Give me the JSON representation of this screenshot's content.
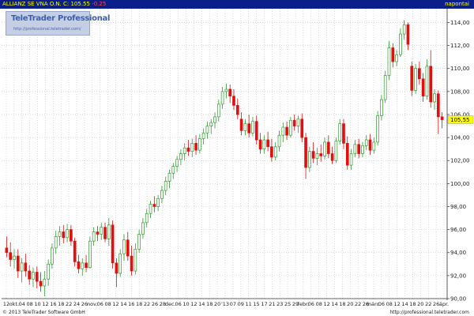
{
  "header": {
    "instrument": "ALLIANZ SE VNA O.N.",
    "close_label": "C:",
    "close": "105.55",
    "change": "-0.25",
    "source": "napontai"
  },
  "logo": {
    "title": "TeleTrader Professional",
    "url": "http://professional.teletrader.com/"
  },
  "footer": {
    "copyright": "© 2013 TeleTrader Software GmbH",
    "url": "http://professional.teletrader.com"
  },
  "colors": {
    "background": "#ffffff",
    "up": "#2e9e2e",
    "down": "#e01010",
    "grid": "#bfbfbf",
    "header": "#0a1f8a"
  },
  "chart_data": {
    "type": "candlestick",
    "yaxis_side": "right",
    "ylim": [
      90,
      115.2
    ],
    "yticks": [
      90,
      92,
      94,
      96,
      98,
      100,
      102,
      104,
      106,
      108,
      110,
      112,
      114
    ],
    "ytick_labels": [
      "90,00",
      "92,00",
      "94,00",
      "96,00",
      "98,00",
      "100,00",
      "102,00",
      "104,00",
      "106,00",
      "108,00",
      "110,00",
      "112,00",
      "114,00"
    ],
    "last_price_label": "105,55",
    "grid": true,
    "x_labels": [
      "12",
      "okt.",
      "04",
      "08",
      "10",
      "12",
      "16",
      "18",
      "22",
      "24",
      "26",
      "nov.",
      "06",
      "08",
      "12",
      "14",
      "16",
      "18",
      "22",
      "26",
      "28",
      "dec.",
      "06",
      "10",
      "12",
      "14",
      "18",
      "20",
      "'13",
      "07",
      "09",
      "11",
      "15",
      "17",
      "21",
      "23",
      "25",
      "29",
      "febr.",
      "06",
      "08",
      "12",
      "14",
      "18",
      "20",
      "22",
      "26",
      "márc.",
      "06",
      "08",
      "12",
      "14",
      "18",
      "20",
      "22",
      "26",
      "ápr."
    ],
    "candles": [
      {
        "o": 94.4,
        "h": 95.4,
        "l": 93.6,
        "c": 94.0
      },
      {
        "o": 94.0,
        "h": 94.9,
        "l": 92.8,
        "c": 93.4
      },
      {
        "o": 93.4,
        "h": 94.3,
        "l": 92.6,
        "c": 93.7
      },
      {
        "o": 93.7,
        "h": 94.3,
        "l": 91.8,
        "c": 92.4
      },
      {
        "o": 92.4,
        "h": 93.5,
        "l": 91.4,
        "c": 93.1
      },
      {
        "o": 93.1,
        "h": 93.9,
        "l": 91.9,
        "c": 92.4
      },
      {
        "o": 92.4,
        "h": 92.9,
        "l": 91.2,
        "c": 91.7
      },
      {
        "o": 91.7,
        "h": 92.7,
        "l": 91.0,
        "c": 92.3
      },
      {
        "o": 92.3,
        "h": 92.8,
        "l": 90.9,
        "c": 91.5
      },
      {
        "o": 91.5,
        "h": 92.3,
        "l": 90.6,
        "c": 91.1
      },
      {
        "o": 91.1,
        "h": 92.4,
        "l": 90.2,
        "c": 91.7
      },
      {
        "o": 91.7,
        "h": 93.4,
        "l": 91.1,
        "c": 93.0
      },
      {
        "o": 93.0,
        "h": 94.8,
        "l": 92.6,
        "c": 94.4
      },
      {
        "o": 94.4,
        "h": 95.9,
        "l": 93.9,
        "c": 95.4
      },
      {
        "o": 95.4,
        "h": 96.3,
        "l": 94.6,
        "c": 95.8
      },
      {
        "o": 95.8,
        "h": 96.4,
        "l": 94.8,
        "c": 95.3
      },
      {
        "o": 95.3,
        "h": 96.5,
        "l": 94.9,
        "c": 96.0
      },
      {
        "o": 96.0,
        "h": 96.4,
        "l": 94.6,
        "c": 95.0
      },
      {
        "o": 95.0,
        "h": 95.3,
        "l": 92.8,
        "c": 93.2
      },
      {
        "o": 93.2,
        "h": 93.8,
        "l": 92.2,
        "c": 92.6
      },
      {
        "o": 92.6,
        "h": 93.5,
        "l": 92.0,
        "c": 93.1
      },
      {
        "o": 93.1,
        "h": 93.8,
        "l": 92.3,
        "c": 92.7
      },
      {
        "o": 92.7,
        "h": 95.4,
        "l": 92.6,
        "c": 95.0
      },
      {
        "o": 95.0,
        "h": 96.2,
        "l": 94.6,
        "c": 95.8
      },
      {
        "o": 95.8,
        "h": 96.3,
        "l": 95.0,
        "c": 95.6
      },
      {
        "o": 95.6,
        "h": 96.6,
        "l": 95.1,
        "c": 96.2
      },
      {
        "o": 96.2,
        "h": 96.6,
        "l": 94.9,
        "c": 95.2
      },
      {
        "o": 95.2,
        "h": 97.0,
        "l": 94.6,
        "c": 96.4
      },
      {
        "o": 96.4,
        "h": 96.8,
        "l": 92.6,
        "c": 93.1
      },
      {
        "o": 93.1,
        "h": 93.5,
        "l": 91.0,
        "c": 92.2
      },
      {
        "o": 92.2,
        "h": 94.3,
        "l": 91.9,
        "c": 93.9
      },
      {
        "o": 93.9,
        "h": 95.6,
        "l": 93.3,
        "c": 95.1
      },
      {
        "o": 95.1,
        "h": 95.8,
        "l": 93.3,
        "c": 93.7
      },
      {
        "o": 93.7,
        "h": 94.6,
        "l": 92.0,
        "c": 92.4
      },
      {
        "o": 92.4,
        "h": 94.8,
        "l": 92.1,
        "c": 94.3
      },
      {
        "o": 94.3,
        "h": 96.0,
        "l": 94.0,
        "c": 95.6
      },
      {
        "o": 95.6,
        "h": 97.0,
        "l": 95.2,
        "c": 96.6
      },
      {
        "o": 96.6,
        "h": 97.8,
        "l": 96.2,
        "c": 97.4
      },
      {
        "o": 97.4,
        "h": 98.5,
        "l": 97.0,
        "c": 98.2
      },
      {
        "o": 98.2,
        "h": 98.9,
        "l": 97.5,
        "c": 98.0
      },
      {
        "o": 98.0,
        "h": 99.0,
        "l": 97.6,
        "c": 98.7
      },
      {
        "o": 98.7,
        "h": 99.8,
        "l": 98.3,
        "c": 99.4
      },
      {
        "o": 99.4,
        "h": 100.6,
        "l": 99.0,
        "c": 100.2
      },
      {
        "o": 100.2,
        "h": 101.2,
        "l": 99.6,
        "c": 100.9
      },
      {
        "o": 100.9,
        "h": 101.8,
        "l": 100.4,
        "c": 101.5
      },
      {
        "o": 101.5,
        "h": 102.4,
        "l": 101.0,
        "c": 102.1
      },
      {
        "o": 102.1,
        "h": 103.0,
        "l": 101.6,
        "c": 102.6
      },
      {
        "o": 102.6,
        "h": 103.5,
        "l": 102.0,
        "c": 103.1
      },
      {
        "o": 103.1,
        "h": 103.8,
        "l": 102.4,
        "c": 102.8
      },
      {
        "o": 102.8,
        "h": 103.9,
        "l": 102.3,
        "c": 103.5
      },
      {
        "o": 103.5,
        "h": 104.2,
        "l": 102.5,
        "c": 102.9
      },
      {
        "o": 102.9,
        "h": 104.3,
        "l": 102.6,
        "c": 103.9
      },
      {
        "o": 103.9,
        "h": 104.8,
        "l": 103.4,
        "c": 104.4
      },
      {
        "o": 104.4,
        "h": 105.4,
        "l": 103.9,
        "c": 105.0
      },
      {
        "o": 105.0,
        "h": 105.6,
        "l": 104.3,
        "c": 105.3
      },
      {
        "o": 105.3,
        "h": 106.2,
        "l": 104.8,
        "c": 105.8
      },
      {
        "o": 105.8,
        "h": 107.3,
        "l": 105.4,
        "c": 106.9
      },
      {
        "o": 106.9,
        "h": 108.4,
        "l": 106.5,
        "c": 108.0
      },
      {
        "o": 108.0,
        "h": 108.7,
        "l": 107.4,
        "c": 108.2
      },
      {
        "o": 108.2,
        "h": 108.6,
        "l": 107.0,
        "c": 107.6
      },
      {
        "o": 107.6,
        "h": 108.2,
        "l": 106.4,
        "c": 106.8
      },
      {
        "o": 106.8,
        "h": 107.4,
        "l": 105.6,
        "c": 106.0
      },
      {
        "o": 105.6,
        "h": 106.2,
        "l": 104.2,
        "c": 104.6
      },
      {
        "o": 104.6,
        "h": 105.6,
        "l": 104.2,
        "c": 105.2
      },
      {
        "o": 105.2,
        "h": 106.0,
        "l": 104.0,
        "c": 104.4
      },
      {
        "o": 104.4,
        "h": 105.8,
        "l": 104.1,
        "c": 105.4
      },
      {
        "o": 105.4,
        "h": 105.9,
        "l": 103.4,
        "c": 103.8
      },
      {
        "o": 103.8,
        "h": 104.4,
        "l": 102.6,
        "c": 103.0
      },
      {
        "o": 103.0,
        "h": 104.2,
        "l": 102.6,
        "c": 103.8
      },
      {
        "o": 103.8,
        "h": 104.5,
        "l": 102.8,
        "c": 103.2
      },
      {
        "o": 103.2,
        "h": 103.9,
        "l": 101.9,
        "c": 102.3
      },
      {
        "o": 102.3,
        "h": 103.6,
        "l": 102.0,
        "c": 103.2
      },
      {
        "o": 103.2,
        "h": 104.6,
        "l": 102.8,
        "c": 104.2
      },
      {
        "o": 104.2,
        "h": 105.3,
        "l": 103.6,
        "c": 104.9
      },
      {
        "o": 104.9,
        "h": 105.4,
        "l": 103.8,
        "c": 104.2
      },
      {
        "o": 104.2,
        "h": 105.8,
        "l": 104.0,
        "c": 105.5
      },
      {
        "o": 105.5,
        "h": 106.0,
        "l": 104.6,
        "c": 105.0
      },
      {
        "o": 105.0,
        "h": 105.9,
        "l": 104.4,
        "c": 105.6
      },
      {
        "o": 105.6,
        "h": 106.1,
        "l": 103.6,
        "c": 104.0
      },
      {
        "o": 104.0,
        "h": 104.4,
        "l": 100.4,
        "c": 101.4
      },
      {
        "o": 101.4,
        "h": 103.2,
        "l": 101.0,
        "c": 102.8
      },
      {
        "o": 102.8,
        "h": 103.6,
        "l": 101.8,
        "c": 102.2
      },
      {
        "o": 102.2,
        "h": 103.1,
        "l": 101.6,
        "c": 102.6
      },
      {
        "o": 102.6,
        "h": 103.4,
        "l": 101.9,
        "c": 102.4
      },
      {
        "o": 102.4,
        "h": 104.0,
        "l": 102.1,
        "c": 103.6
      },
      {
        "o": 103.6,
        "h": 104.2,
        "l": 102.2,
        "c": 102.6
      },
      {
        "o": 102.6,
        "h": 103.2,
        "l": 101.7,
        "c": 102.0
      },
      {
        "o": 102.0,
        "h": 104.0,
        "l": 101.8,
        "c": 103.7
      },
      {
        "o": 103.7,
        "h": 105.6,
        "l": 103.4,
        "c": 105.2
      },
      {
        "o": 105.2,
        "h": 105.6,
        "l": 103.0,
        "c": 103.5
      },
      {
        "o": 103.5,
        "h": 104.1,
        "l": 101.2,
        "c": 101.6
      },
      {
        "o": 101.6,
        "h": 103.0,
        "l": 101.2,
        "c": 102.6
      },
      {
        "o": 102.6,
        "h": 103.8,
        "l": 102.3,
        "c": 103.4
      },
      {
        "o": 103.4,
        "h": 103.9,
        "l": 102.2,
        "c": 102.6
      },
      {
        "o": 102.6,
        "h": 103.6,
        "l": 102.3,
        "c": 103.3
      },
      {
        "o": 103.3,
        "h": 104.2,
        "l": 102.9,
        "c": 103.8
      },
      {
        "o": 103.8,
        "h": 104.3,
        "l": 102.5,
        "c": 102.9
      },
      {
        "o": 102.9,
        "h": 104.0,
        "l": 102.6,
        "c": 103.6
      },
      {
        "o": 103.6,
        "h": 106.3,
        "l": 103.3,
        "c": 105.9
      },
      {
        "o": 105.9,
        "h": 107.7,
        "l": 105.5,
        "c": 107.3
      },
      {
        "o": 107.3,
        "h": 109.8,
        "l": 107.0,
        "c": 109.4
      },
      {
        "o": 109.4,
        "h": 112.4,
        "l": 109.0,
        "c": 111.8
      },
      {
        "o": 111.8,
        "h": 112.2,
        "l": 110.1,
        "c": 110.6
      },
      {
        "o": 110.6,
        "h": 111.6,
        "l": 110.2,
        "c": 111.2
      },
      {
        "o": 111.2,
        "h": 113.5,
        "l": 111.0,
        "c": 113.0
      },
      {
        "o": 113.0,
        "h": 114.2,
        "l": 112.5,
        "c": 113.8
      },
      {
        "o": 113.8,
        "h": 114.0,
        "l": 111.6,
        "c": 112.1
      },
      {
        "o": 110.2,
        "h": 110.6,
        "l": 107.6,
        "c": 108.1
      },
      {
        "o": 108.1,
        "h": 110.4,
        "l": 107.8,
        "c": 110.0
      },
      {
        "o": 110.0,
        "h": 110.6,
        "l": 108.6,
        "c": 109.1
      },
      {
        "o": 109.1,
        "h": 109.6,
        "l": 107.1,
        "c": 107.6
      },
      {
        "o": 107.6,
        "h": 110.8,
        "l": 107.3,
        "c": 110.2
      },
      {
        "o": 110.2,
        "h": 111.6,
        "l": 106.6,
        "c": 107.1
      },
      {
        "o": 107.1,
        "h": 108.2,
        "l": 106.4,
        "c": 107.8
      },
      {
        "o": 107.8,
        "h": 108.1,
        "l": 104.3,
        "c": 105.8
      },
      {
        "o": 105.8,
        "h": 106.2,
        "l": 104.8,
        "c": 105.55
      }
    ]
  }
}
